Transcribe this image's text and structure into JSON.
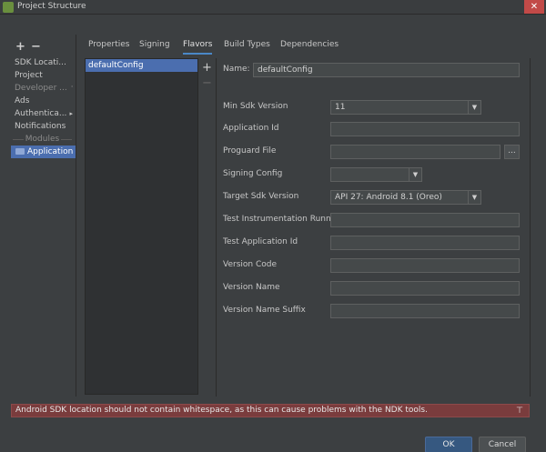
{
  "window": {
    "title": "Project Structure",
    "close_glyph": "✕"
  },
  "toolbar": {
    "add": "+",
    "remove": "−"
  },
  "sidebar": {
    "items": [
      {
        "label": "SDK Locati...",
        "dim": false
      },
      {
        "label": "Project",
        "dim": false
      },
      {
        "label": "Developer ... ",
        "dim": true
      },
      {
        "label": "Ads",
        "dim": false
      },
      {
        "label": "Authentica...",
        "dim": false
      },
      {
        "label": "Notifications",
        "dim": false
      }
    ],
    "modules_header": "Modules",
    "selected_module": "Application"
  },
  "tabs": [
    "Properties",
    "Signing",
    "Flavors",
    "Build Types",
    "Dependencies"
  ],
  "active_tab": "Flavors",
  "flavors": {
    "items": [
      "defaultConfig"
    ],
    "add": "+",
    "remove": "−"
  },
  "form": {
    "name_label": "Name:",
    "name_value": "defaultConfig",
    "min_sdk_label": "Min Sdk Version",
    "min_sdk_value": "11",
    "app_id_label": "Application Id",
    "proguard_label": "Proguard File",
    "browse_label": "...",
    "signing_label": "Signing Config",
    "target_sdk_label": "Target Sdk Version",
    "target_sdk_value": "API 27: Android 8.1 (Oreo)",
    "test_runner_label": "Test Instrumentation Runner",
    "test_app_id_label": "Test Application Id",
    "version_code_label": "Version Code",
    "version_name_label": "Version Name",
    "version_suffix_label": "Version Name Suffix"
  },
  "warning": {
    "text": "Android SDK location should not contain whitespace, as this can cause problems with the NDK tools."
  },
  "buttons": {
    "ok": "OK",
    "cancel": "Cancel"
  },
  "colors": {
    "accent": "#4b6eaf",
    "ok_button": "#365880",
    "warning_bg": "#7a3c3d",
    "close_button": "#c24a48"
  },
  "icons": {
    "module_icon": "folder-icon",
    "warning_icon": "pin-icon",
    "dropdown_icon": "chevron-down-icon"
  }
}
